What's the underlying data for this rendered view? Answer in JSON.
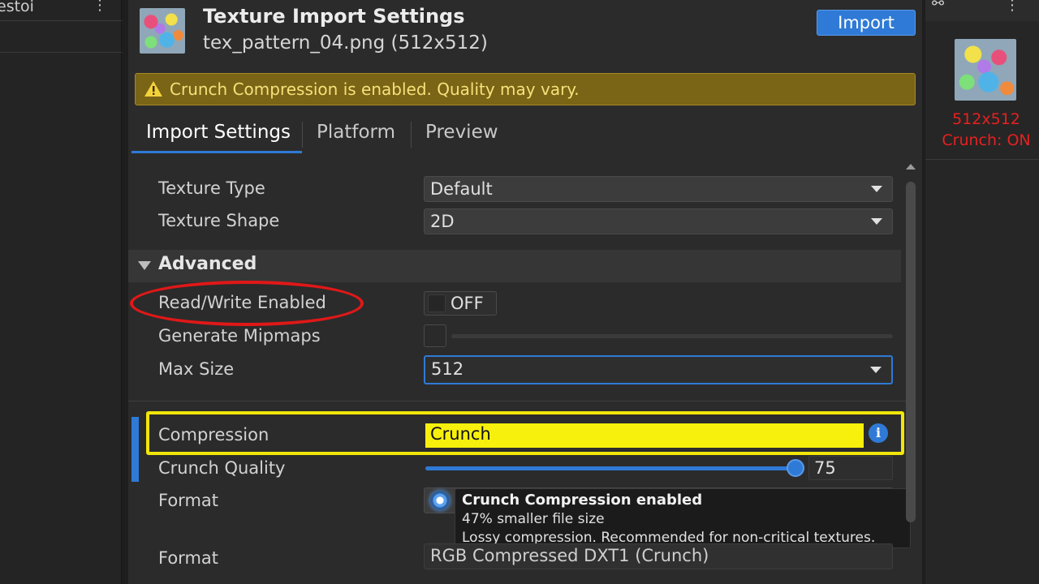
{
  "left_panel": {
    "tab_label": "estoi",
    "menu_icon": "kebab-icon"
  },
  "header": {
    "title": "Texture Import Settings",
    "subtitle": "tex_pattern_04.png (512x512)",
    "import_label": "Import"
  },
  "warning": {
    "icon": "warning-icon",
    "text": "Crunch Compression is enabled. Quality may vary."
  },
  "tabs": [
    {
      "label": "Import Settings",
      "active": true
    },
    {
      "label": "Platform",
      "active": false
    },
    {
      "label": "Preview",
      "active": false
    }
  ],
  "fields": {
    "texture_type": {
      "label": "Texture Type",
      "value": "Default"
    },
    "texture_shape": {
      "label": "Texture Shape",
      "value": "2D"
    },
    "advanced": {
      "label": "Advanced"
    },
    "read_write": {
      "label": "Read/Write Enabled",
      "value": "OFF"
    },
    "mipmaps": {
      "label": "Generate Mipmaps"
    },
    "max_size": {
      "label": "Max Size",
      "value": "512"
    },
    "compression": {
      "label": "Compression",
      "value": "Crunch"
    },
    "crunch_quality": {
      "label": "Crunch Quality",
      "value": "75",
      "level": 0.75
    },
    "format": {
      "label": "Format"
    },
    "format2": {
      "label": "Format",
      "value": "RGB Compressed DXT1 (Crunch)"
    }
  },
  "tooltip": {
    "title": "Crunch Compression enabled",
    "line1": "47% smaller file size",
    "line2": "Lossy compression. Recommended for non-critical textures."
  },
  "right_panel": {
    "size_text": "512x512",
    "crunch_text": "Crunch: ON"
  },
  "colors": {
    "accent": "#2f7ad6",
    "warning_bg": "#7a6416",
    "highlight_yellow": "#f7f00c",
    "annotation_red": "#e01818"
  }
}
